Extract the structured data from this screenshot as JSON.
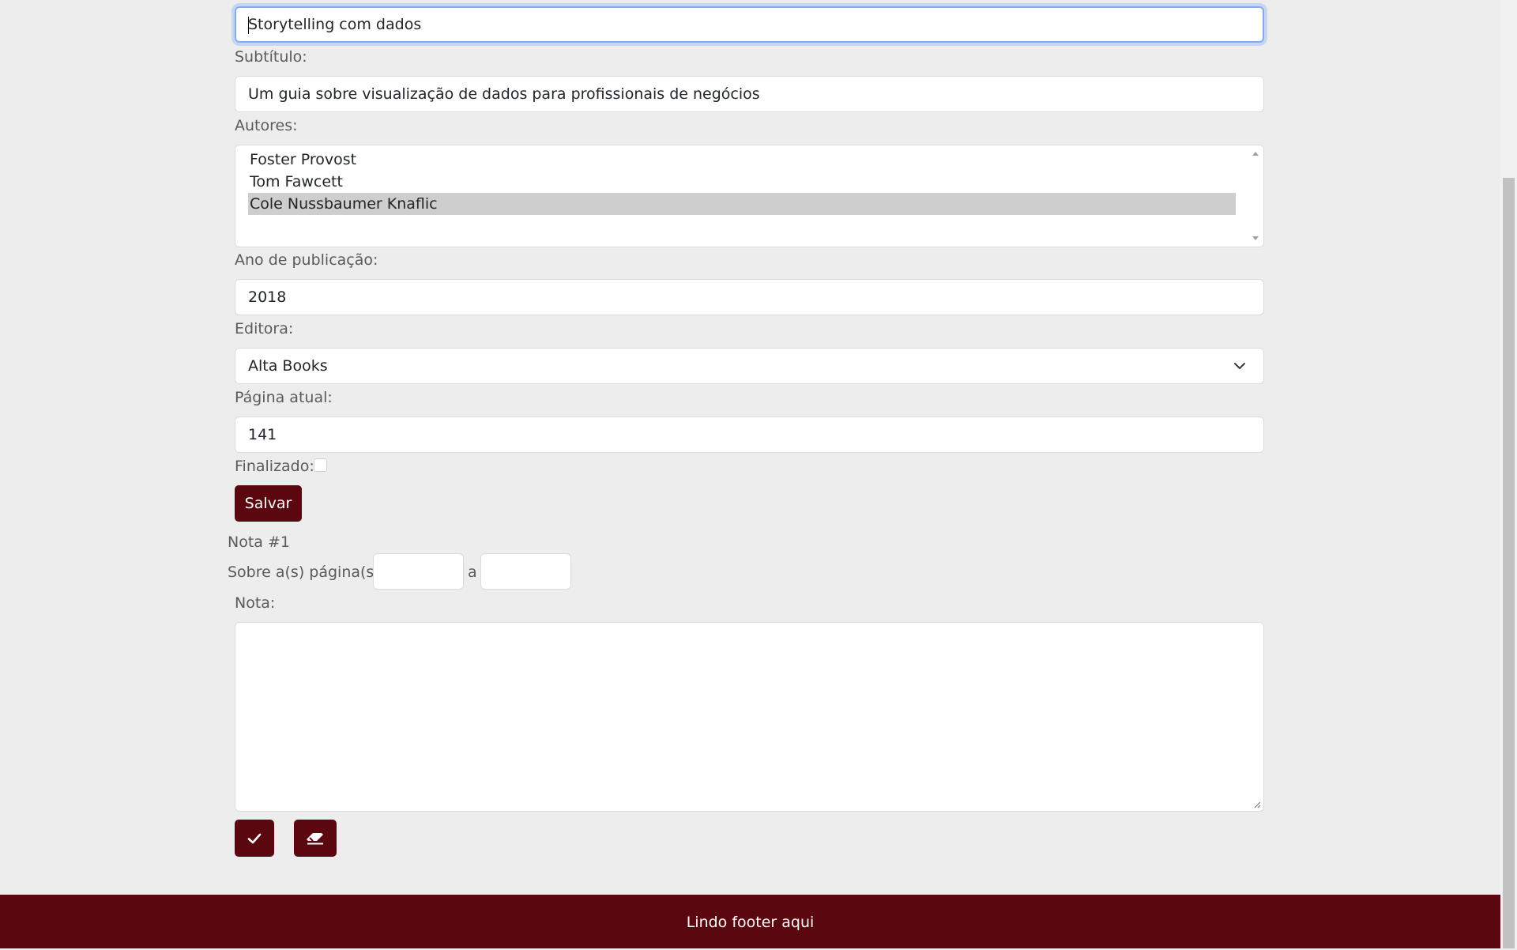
{
  "form": {
    "title_value": "Storytelling com dados",
    "subtitle_label": "Subtítulo:",
    "subtitle_value": "Um guia sobre visualização de dados para profissionais de negócios",
    "authors_label": "Autores:",
    "authors": [
      {
        "name": "Foster Provost",
        "selected": false
      },
      {
        "name": "Tom Fawcett",
        "selected": false
      },
      {
        "name": "Cole Nussbaumer Knaflic",
        "selected": true
      }
    ],
    "year_label": "Ano de publicação:",
    "year_value": "2018",
    "publisher_label": "Editora:",
    "publisher_value": "Alta Books",
    "current_page_label": "Página atual:",
    "current_page_value": "141",
    "finished_label": "Finalizado:",
    "finished_checked": false,
    "save_label": "Salvar"
  },
  "note": {
    "heading": "Nota #1",
    "pages_label": "Sobre a(s) página(s):",
    "pages_from_value": "",
    "pages_separator": "a",
    "pages_to_value": "",
    "note_label": "Nota:",
    "note_value": "",
    "confirm_icon": "check-icon",
    "clear_icon": "eraser-icon"
  },
  "footer": {
    "text": "Lindo footer aqui"
  },
  "colors": {
    "accent": "#5a0710",
    "background": "#ededed",
    "focus_border": "#86aaf0"
  }
}
